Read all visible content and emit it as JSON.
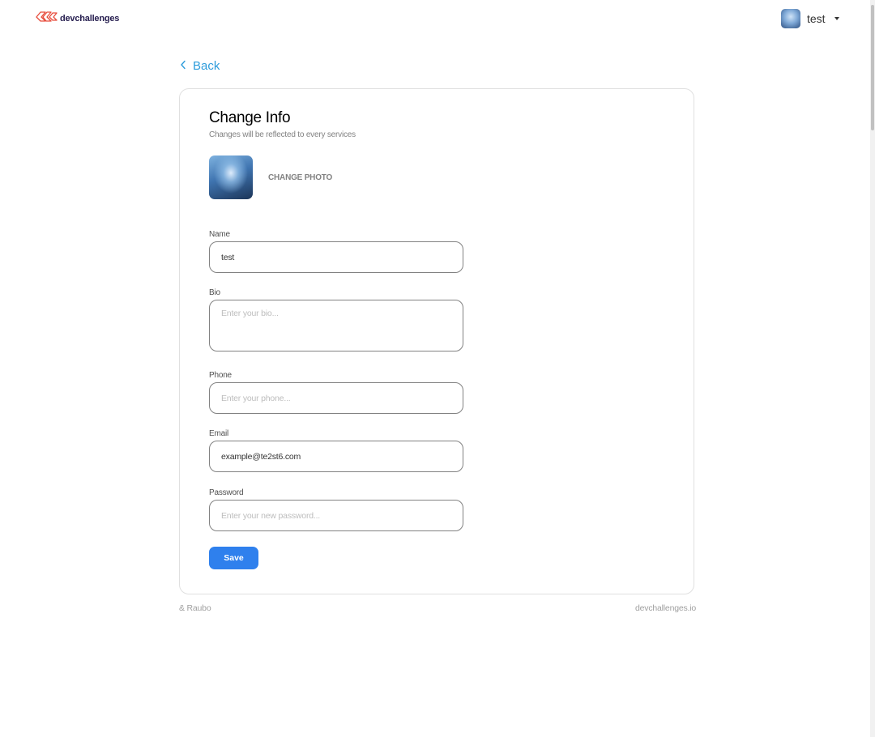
{
  "header": {
    "logo_text": "devchallenges",
    "user_name": "test"
  },
  "nav": {
    "back_label": "Back"
  },
  "card": {
    "title": "Change Info",
    "subtitle": "Changes will be reflected to every services",
    "change_photo_label": "CHANGE PHOTO"
  },
  "form": {
    "name": {
      "label": "Name",
      "value": "test",
      "placeholder": ""
    },
    "bio": {
      "label": "Bio",
      "value": "",
      "placeholder": "Enter your bio..."
    },
    "phone": {
      "label": "Phone",
      "value": "",
      "placeholder": "Enter your phone..."
    },
    "email": {
      "label": "Email",
      "value": "example@te2st6.com",
      "placeholder": ""
    },
    "password": {
      "label": "Password",
      "value": "",
      "placeholder": "Enter your new password..."
    },
    "save_label": "Save"
  },
  "footer": {
    "left_text": "& Raubo",
    "right_text": "devchallenges.io"
  },
  "colors": {
    "accent_blue": "#2F80ED",
    "link_blue": "#2D9CDB",
    "logo_red": "#E74C3C",
    "logo_text": "#282051"
  },
  "icons": {
    "logo": "devchallenges-logo-icon",
    "back": "chevron-left-icon",
    "menu_caret": "caret-down-icon"
  }
}
